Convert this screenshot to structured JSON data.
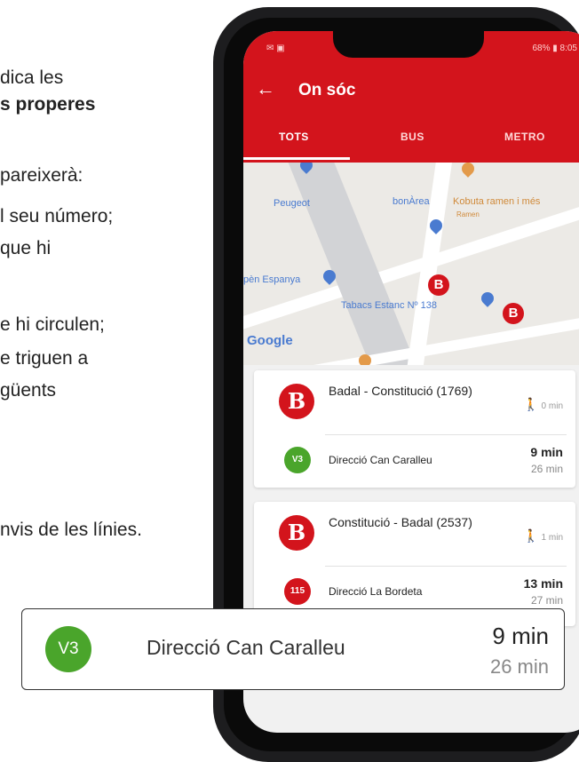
{
  "left_text": {
    "line1": "dica les",
    "line2": "s properes",
    "line3": "pareixerà:",
    "line4": "l seu número;",
    "line5": "que hi",
    "line6": "e hi circulen;",
    "line7": "e triguen a",
    "line8": "güents",
    "line9": "nvis de les línies."
  },
  "app": {
    "status_right": "68% ▮ 8:05",
    "back": "←",
    "title": "On sóc",
    "tabs": [
      "TOTS",
      "BUS",
      "METRO"
    ],
    "active_tab": "TOTS"
  },
  "map": {
    "labels": [
      "Peugeot",
      "bonÀrea",
      "Kobuta ramen i més",
      "Ramen",
      "pèn Espanya",
      "Tabacs Estanc Nº 138"
    ],
    "provider": "Google",
    "marker_letter": "B"
  },
  "stops": [
    {
      "name": "Badal - Constitució (1769)",
      "walk": "0 min",
      "lines": [
        {
          "code": "V3",
          "direction": "Direcció Can Caralleu",
          "next": "9 min",
          "after": "26 min",
          "color": "#4aa52b"
        }
      ]
    },
    {
      "name": "Constitució - Badal (2537)",
      "walk": "1 min",
      "lines": [
        {
          "code": "115",
          "direction": "Direcció La Bordeta",
          "next": "13 min",
          "after": "27 min",
          "color": "#d3141c"
        }
      ]
    }
  ],
  "popout": {
    "code": "V3",
    "direction": "Direcció Can Caralleu",
    "next": "9 min",
    "after": "26 min",
    "color": "#4aa52b"
  },
  "colors": {
    "brand": "#d3141c",
    "v3": "#4aa52b"
  },
  "icons": [
    "back-arrow-icon",
    "walking-person-icon",
    "map-pin-icon",
    "bus-stop-marker-icon"
  ]
}
